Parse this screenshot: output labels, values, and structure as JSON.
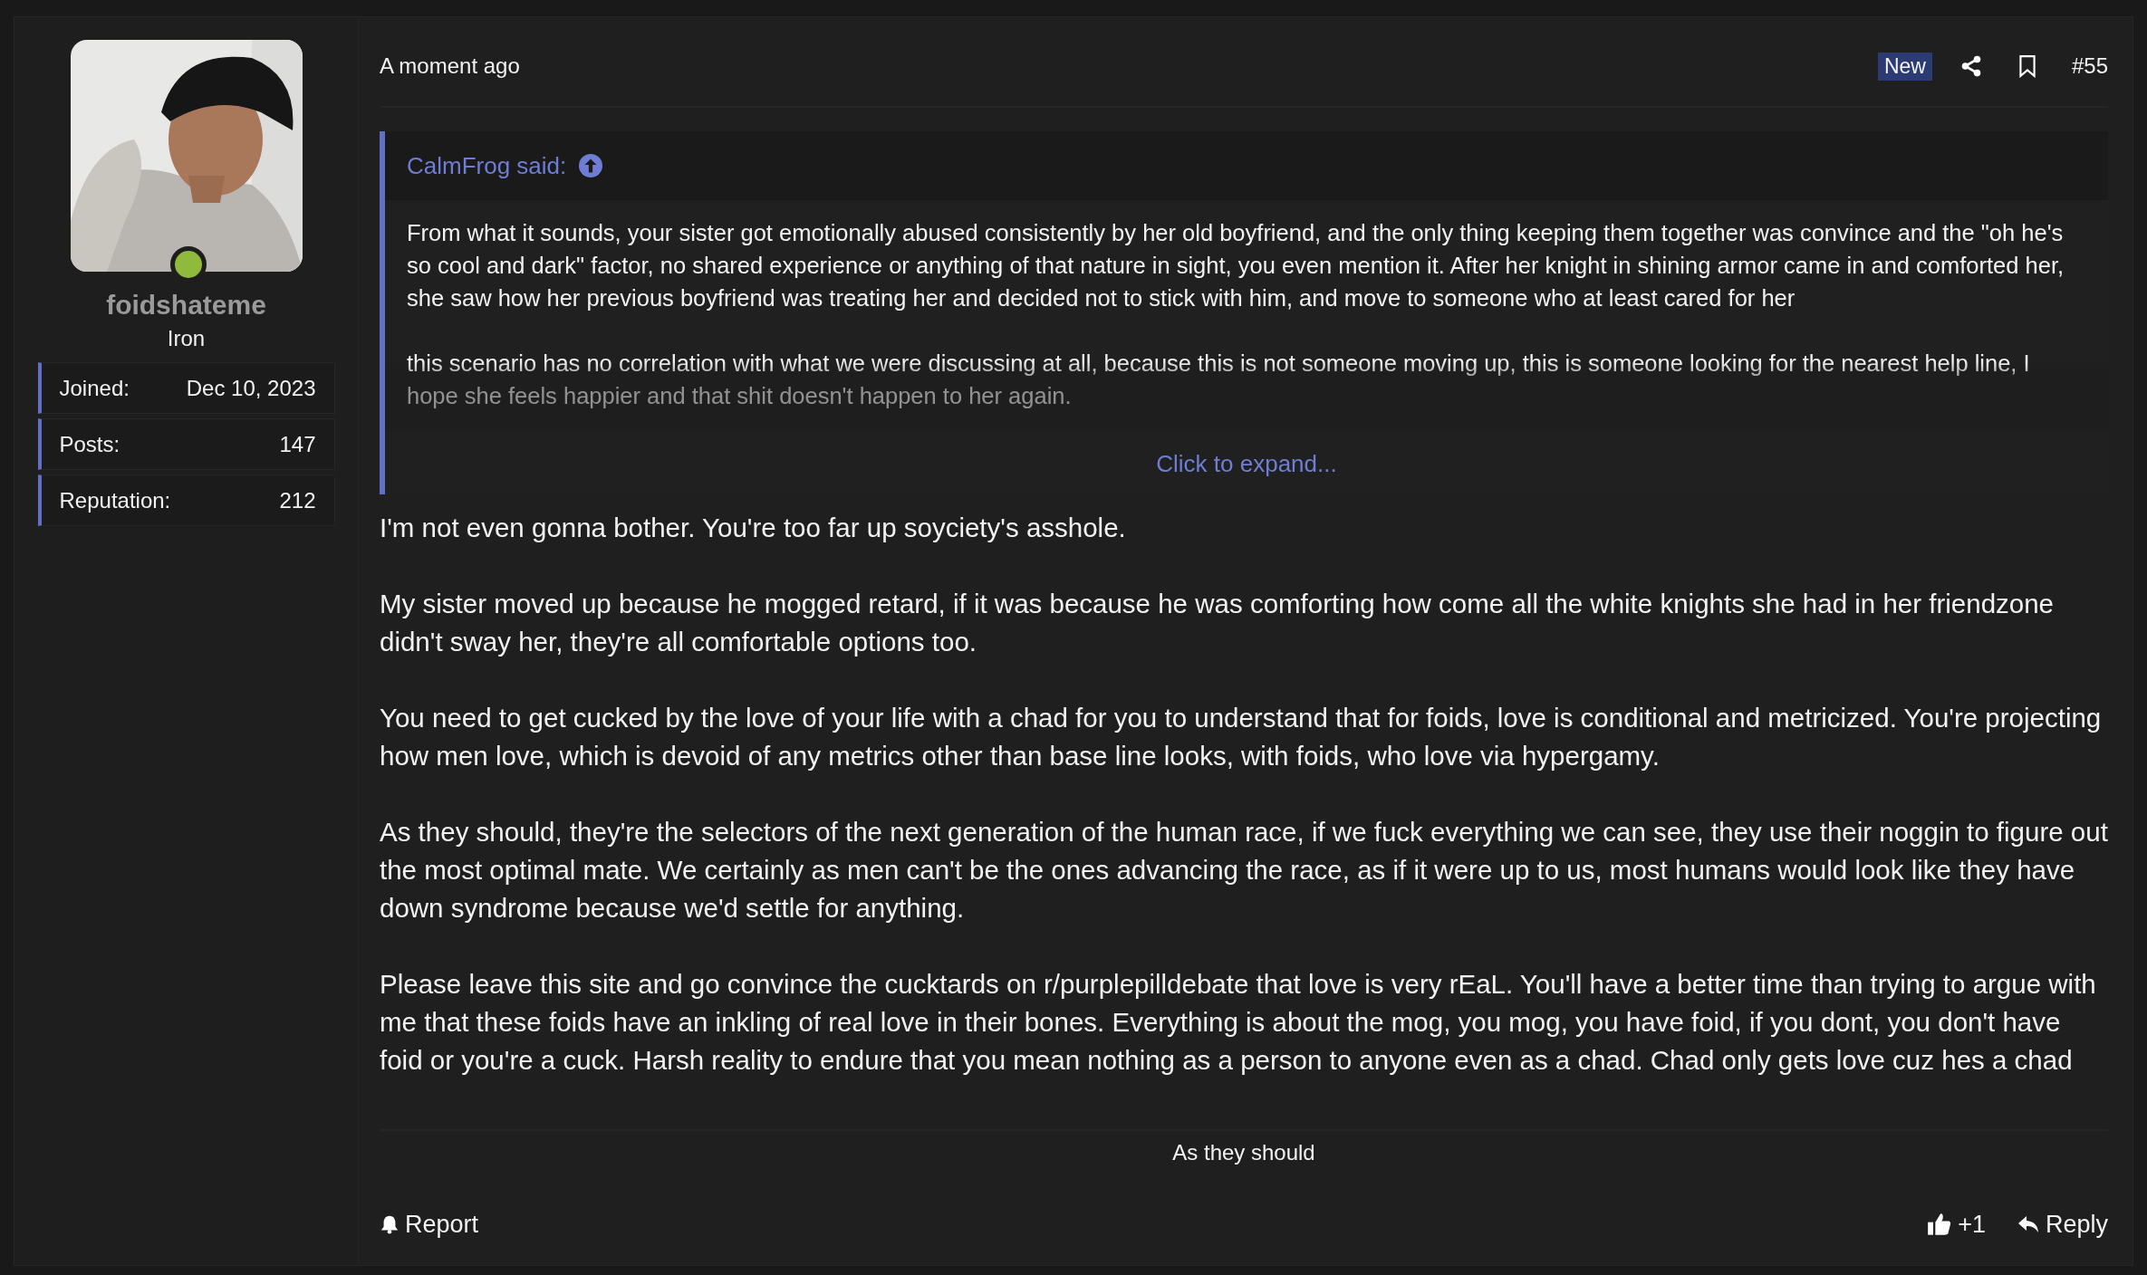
{
  "author": {
    "online": true,
    "username": "foidshateme",
    "rank": "Iron",
    "stats": [
      {
        "label": "Joined:",
        "value": "Dec 10, 2023"
      },
      {
        "label": "Posts:",
        "value": "147"
      },
      {
        "label": "Reputation:",
        "value": "212"
      }
    ]
  },
  "post": {
    "time": "A moment ago",
    "badge": "New",
    "number": "#55",
    "quote": {
      "author": "CalmFrog said:",
      "paragraphs": [
        "From what it sounds, your sister got emotionally abused consistently by her old boyfriend, and the only thing keeping them together was convince and the \"oh he's so cool and dark\" factor, no shared experience or anything of that nature in sight, you even mention it. After her knight in shining armor came in and comforted her, she saw how her previous boyfriend was treating her and decided not to stick with him, and move to someone who at least cared for her",
        "this scenario has no correlation with what we were discussing at all, because this is not someone moving up, this is someone looking for the nearest help line, I hope she feels happier and that shit doesn't happen to her again."
      ],
      "expand": "Click to expand..."
    },
    "body": [
      "I'm not even gonna bother. You're too far up soyciety's asshole.",
      "My sister moved up because he mogged retard, if it was because he was comforting how come all the white knights she had in her friendzone didn't sway her, they're all comfortable options too.",
      "You need to get cucked by the love of your life with a chad for you to understand that for foids, love is conditional and metricized. You're projecting how men love, which is devoid of any metrics other than base line looks, with foids, who love via hypergamy.",
      "As they should, they're the selectors of the next generation of the human race, if we fuck everything we can see, they use their noggin to figure out the most optimal mate. We certainly as men can't be the ones advancing the race, as if it were up to us, most humans would look like they have down syndrome because we'd settle for anything.",
      "Please leave this site and go convince the cucktards on r/purplepilldebate that love is very rEaL. You'll have a better time than trying to argue with me that these foids have an inkling of real love in their bones. Everything is about the mog, you mog, you have foid, if you dont, you don't have foid or you're a cuck. Harsh reality to endure that you mean nothing as a person to anyone even as a chad. Chad only gets love cuz hes a chad"
    ],
    "signature": "As they should",
    "actions": {
      "report": "Report",
      "likes": "+1",
      "reply": "Reply"
    }
  }
}
